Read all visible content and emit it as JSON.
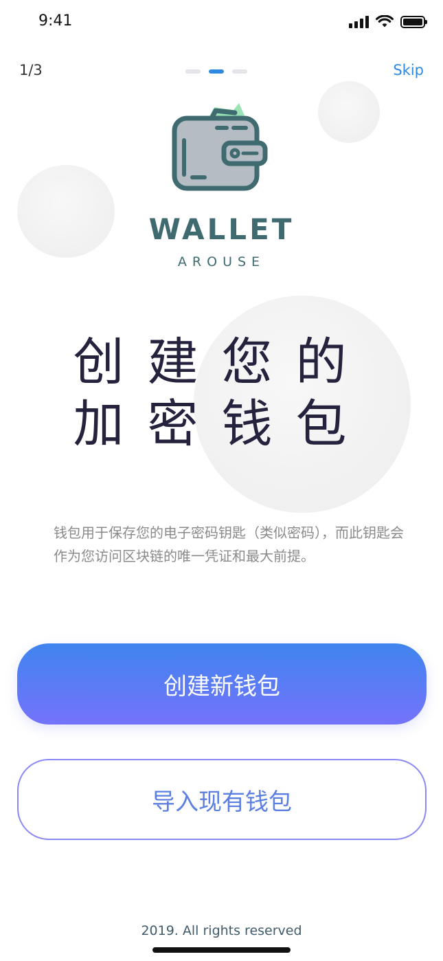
{
  "status_bar": {
    "time": "9:41"
  },
  "nav": {
    "page_counter": "1/3",
    "skip_label": "Skip",
    "active_dot": 1,
    "total_dots": 3
  },
  "logo": {
    "title": "WALLET",
    "subtitle": "AROUSE",
    "colors": {
      "primary": "#3e6a70",
      "body": "#b5bcc3",
      "money": "#9be3b5"
    }
  },
  "main": {
    "heading_line1": "创建您的",
    "heading_line2": "加密钱包",
    "description": "钱包用于保存您的电子密码钥匙（类似密码），而此钥匙会作为您访问区块链的唯一凭证和最大前提。"
  },
  "actions": {
    "create_wallet_label": "创建新钱包",
    "import_wallet_label": "导入现有钱包"
  },
  "footer": {
    "copyright": "2019. All rights reserved"
  },
  "colors": {
    "accent_blue": "#2d8ae0",
    "gradient_start": "#3f84ef",
    "gradient_end": "#7573fb"
  }
}
